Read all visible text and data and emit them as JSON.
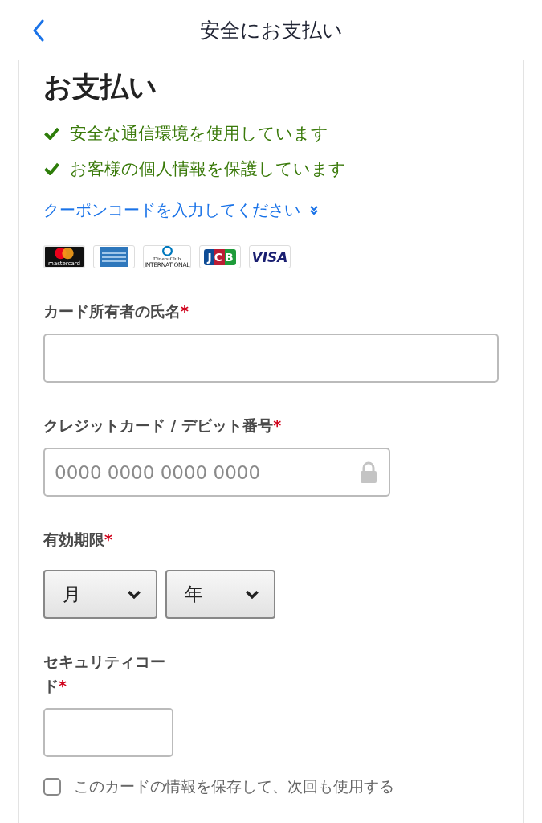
{
  "header": {
    "title": "安全にお支払い"
  },
  "payment": {
    "heading": "お支払い",
    "assurances": [
      "安全な通信環境を使用しています",
      "お客様の個人情報を保護しています"
    ],
    "coupon_link": "クーポンコードを入力してください",
    "card_logos": [
      {
        "kind": "mastercard",
        "text": "mastercard"
      },
      {
        "kind": "amex"
      },
      {
        "kind": "diners",
        "text": "Diners Club",
        "subtext": "INTERNATIONAL"
      },
      {
        "kind": "jcb",
        "text": "JCB"
      },
      {
        "kind": "visa",
        "text": "VISA"
      }
    ],
    "fields": [
      {
        "kind": "text",
        "label": "カード所有者の氏名",
        "required_mark": "*"
      },
      {
        "kind": "card",
        "label": "クレジットカード / デビット番号",
        "required_mark": "*",
        "placeholder": "0000 0000 0000 0000"
      },
      {
        "kind": "expiry",
        "label": "有効期限",
        "required_mark": "*",
        "selects": [
          "月",
          "年"
        ]
      },
      {
        "kind": "cvc",
        "label": "セキュリティコード",
        "required_mark": "*"
      }
    ],
    "save_card": {
      "label": "このカードの情報を保存して、次回も使用する",
      "checked": false
    }
  }
}
